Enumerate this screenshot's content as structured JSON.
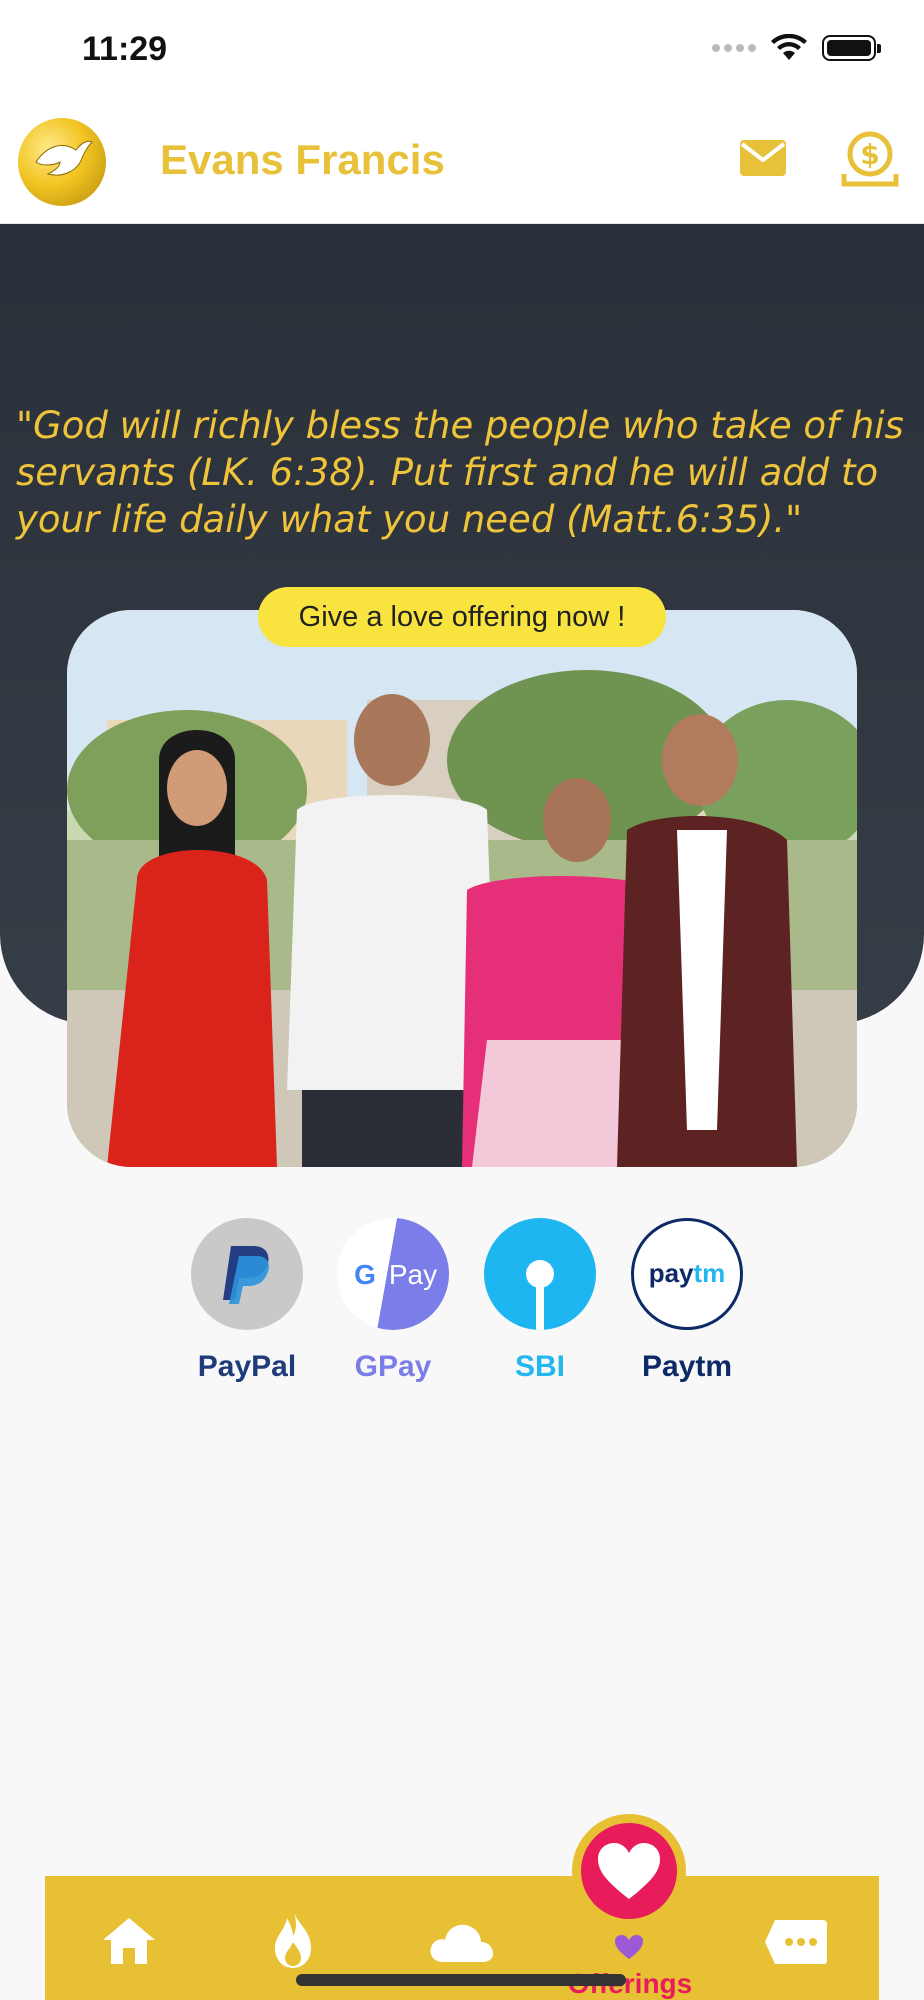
{
  "status_bar": {
    "time": "11:29"
  },
  "header": {
    "title": "Evans Francis",
    "logo_icon": "dove-logo-icon",
    "mail_icon": "mail-icon",
    "money_icon": "donate-dollar-icon"
  },
  "hero": {
    "quote": "\"God will richly bless the people who take of his servants (LK. 6:38). Put first and he will add to your life daily what you need (Matt.6:35).\"",
    "offer_pill": "Give a love offering now !"
  },
  "payments": [
    {
      "label": "PayPal",
      "icon": "paypal-icon",
      "color": "#1f3b7a"
    },
    {
      "label": "GPay",
      "icon": "gpay-icon",
      "color": "#7b7de8"
    },
    {
      "label": "SBI",
      "icon": "sbi-icon",
      "color": "#22b7ee"
    },
    {
      "label": "Paytm",
      "icon": "paytm-icon",
      "color": "#0d2a66"
    }
  ],
  "bottom_nav": {
    "items": [
      {
        "icon": "home-icon"
      },
      {
        "icon": "flame-icon"
      },
      {
        "icon": "cloud-icon"
      },
      {
        "icon": "heart-icon",
        "label": "Offerings",
        "active": true
      },
      {
        "icon": "message-icon"
      }
    ]
  },
  "colors": {
    "accent_yellow": "#e8c033",
    "quote_yellow": "#efc43a",
    "active_pink": "#e81c5b",
    "hero_dark": "#2a3039"
  }
}
